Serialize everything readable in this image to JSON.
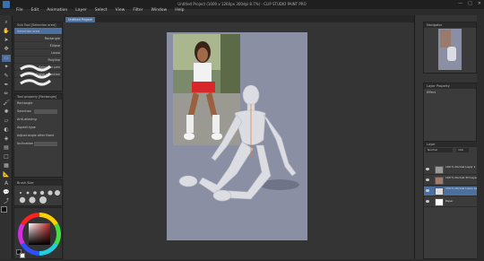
{
  "window": {
    "title": "Untitled Project (1000 x 1260px 300dpi 8.7%)  - CLIP STUDIO PAINT PRO",
    "controls": [
      "—",
      "□",
      "✕"
    ]
  },
  "menu": [
    "File",
    "Edit",
    "Animation",
    "Layer",
    "Select",
    "View",
    "Filter",
    "Window",
    "Help"
  ],
  "tabs": [
    {
      "label": "Untitled Project"
    }
  ],
  "subtool_panel": {
    "header": "Sub Tool [Selection area]",
    "items": [
      {
        "label": "Selection area",
        "selected": true
      },
      {
        "label": "Rectangle"
      },
      {
        "label": "Ellipse"
      },
      {
        "label": "Lasso"
      },
      {
        "label": "Polyline"
      },
      {
        "label": "Selection pen"
      },
      {
        "label": "Erase selection"
      }
    ]
  },
  "tool_property": {
    "header": "Tool property [Rectangle]",
    "tool_name": "Rectangle",
    "rows": [
      {
        "label": "Selection"
      },
      {
        "label": "Anti-aliasing"
      },
      {
        "label": "Aspect type"
      },
      {
        "label": "Adjust angle after fixed"
      },
      {
        "label": "Inclination"
      }
    ]
  },
  "brush_size": {
    "header": "Brush Size"
  },
  "colors": {
    "accent": "#4d6f9e",
    "main": "#111111",
    "sub": "#ffffff",
    "wheel_square": "#c02020"
  },
  "right_panels": {
    "navigator": {
      "header": "Navigator"
    },
    "layer_property": {
      "header": "Layer Property",
      "effect_label": "Effect"
    },
    "layers": {
      "header": "Layer",
      "blend_mode": "Normal",
      "opacity": "100",
      "items": [
        {
          "name": "100 % Normal  Layer 1",
          "visible": true
        },
        {
          "name": "100 % Normal  3D Layer",
          "visible": true
        },
        {
          "name": "100 % Normal  Lasso Layer",
          "visible": true,
          "selected": true
        },
        {
          "name": "Paper",
          "visible": true
        }
      ]
    }
  },
  "canvas": {
    "paper_color": "#8b8fa4"
  }
}
